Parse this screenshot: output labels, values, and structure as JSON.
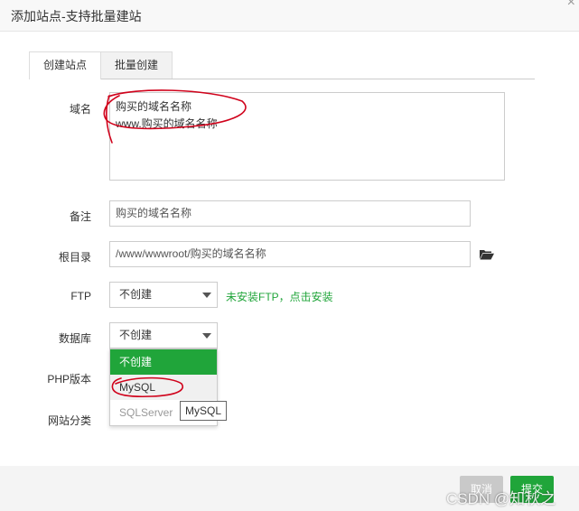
{
  "dialog": {
    "title": "添加站点-支持批量建站"
  },
  "tabs": [
    {
      "label": "创建站点",
      "active": true
    },
    {
      "label": "批量创建",
      "active": false
    }
  ],
  "form": {
    "domain": {
      "label": "域名",
      "value": "购买的域名名称\nwww.购买的域名名称"
    },
    "remark": {
      "label": "备注",
      "value": "购买的域名名称"
    },
    "root": {
      "label": "根目录",
      "value": "/www/wwwroot/购买的域名名称",
      "icon": "folder-open-icon"
    },
    "ftp": {
      "label": "FTP",
      "selected": "不创建",
      "hint": "未安装FTP，点击安装"
    },
    "database": {
      "label": "数据库",
      "selected": "不创建",
      "options": [
        "不创建",
        "MySQL",
        "SQLServer"
      ],
      "tooltip": "MySQL"
    },
    "php": {
      "label": "PHP版本"
    },
    "category": {
      "label": "网站分类"
    }
  },
  "footer": {
    "cancel_label": "取消",
    "submit_label": "提交"
  },
  "watermark": "CSDN @知秋之",
  "colors": {
    "accent": "#20a53a",
    "annotation": "#d0021b"
  }
}
